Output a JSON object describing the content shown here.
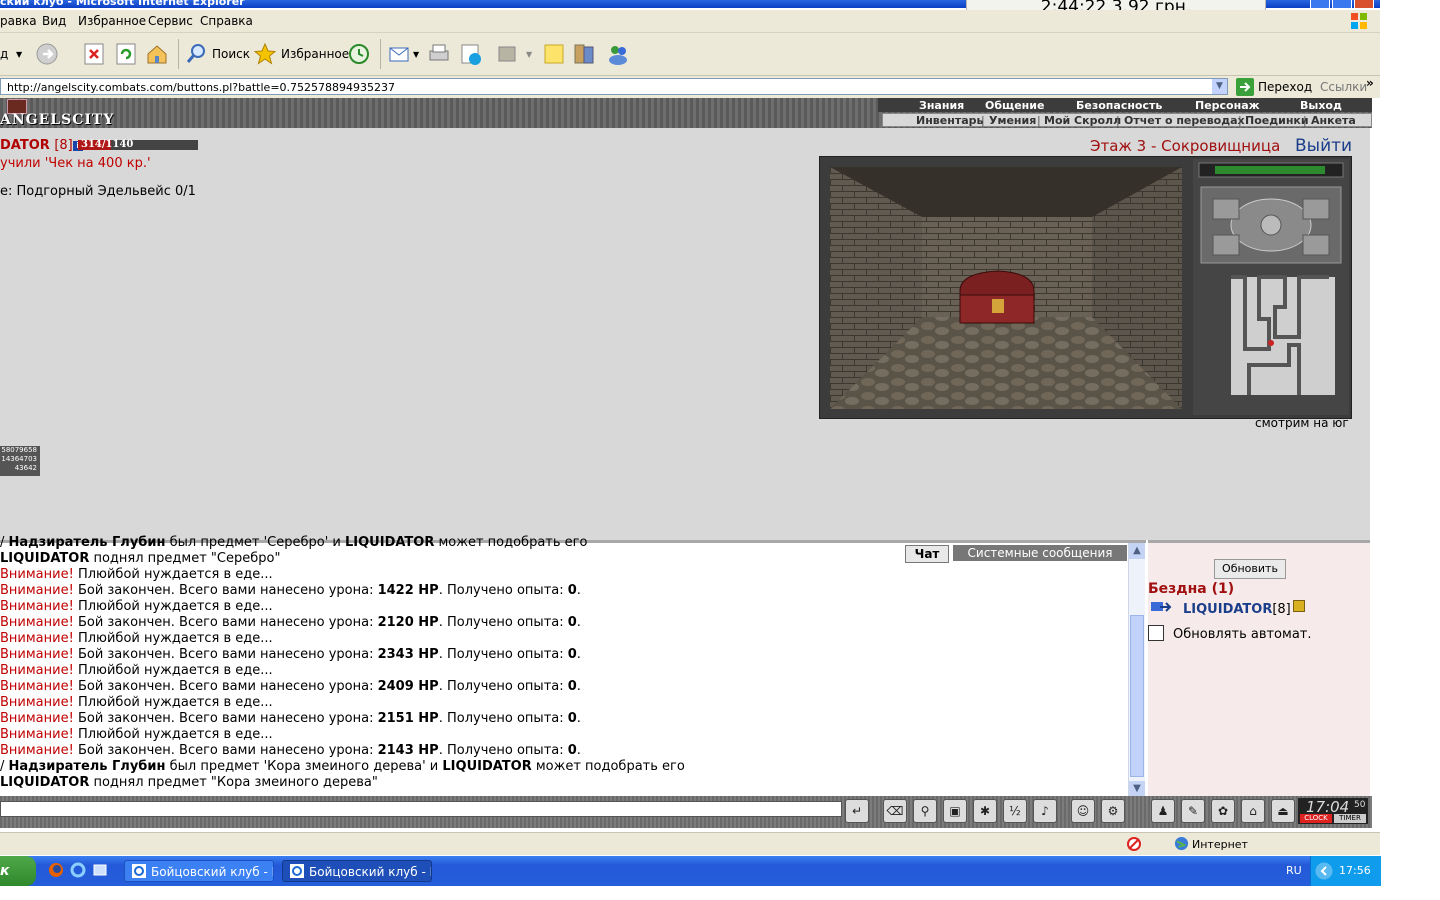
{
  "window": {
    "title": "ский клуб - Microsoft Internet Explorer",
    "clock_popup": "2:44:22  3.92 грн."
  },
  "menu": {
    "items": [
      "равка",
      "Вид",
      "Избранное",
      "Сервис",
      "Справка"
    ]
  },
  "toolbar": {
    "back_label": "д",
    "search_label": "Поиск",
    "favorites_label": "Избранное"
  },
  "address": {
    "url": "http://angelscity.combats.com/buttons.pl?battle=0.752578894935237",
    "go_label": "Переход",
    "links_label": "Ссылки"
  },
  "game": {
    "logo": "ANGELSCITY",
    "nav_top": [
      "Знания",
      "Общение",
      "Безопасность",
      "Персонаж",
      "Выход"
    ],
    "nav_bottom": [
      "Инвентарь",
      "Умения",
      "Мой Скролл",
      "Отчет о переводах",
      "Поединки",
      "Анкета"
    ],
    "player": {
      "name": "DATOR",
      "level": "[8]",
      "hp_text": "314/1140",
      "hp_current": 314,
      "hp_max": 1140
    },
    "receipt_message": "учили 'Чек на 400 кр.'",
    "quest_text": "е: Подгорный Эдельвейс 0/1",
    "coords_lines": [
      "58079658",
      "14364703",
      "43642"
    ],
    "floor_title": "Этаж 3 - Сокровищница",
    "exit_label": "Выйти",
    "facing": "смотрим на юг"
  },
  "chat": {
    "tabs": [
      "Чат",
      "Системные сообщения"
    ],
    "lines": [
      {
        "prefix": "/ ",
        "bold": "Надзиратель Глубин",
        "text": " был предмет 'Серебро' и ",
        "bold2": "LIQUIDATOR",
        "text2": " может подобрать его"
      },
      {
        "prefix": "",
        "bold": "LIQUIDATOR",
        "text": " поднял предмет \"Серебро\"",
        "bold2": "",
        "text2": ""
      },
      {
        "warn": "Внимание!",
        "text": " Плюйбой нуждается в еде..."
      },
      {
        "warn": "Внимание!",
        "text": " Бой закончен. Всего вами нанесено урона: ",
        "dmg": "1422 HP",
        "text2": ". Получено опыта: ",
        "exp": "0",
        "end": "."
      },
      {
        "warn": "Внимание!",
        "text": " Плюйбой нуждается в еде..."
      },
      {
        "warn": "Внимание!",
        "text": " Бой закончен. Всего вами нанесено урона: ",
        "dmg": "2120 HP",
        "text2": ". Получено опыта: ",
        "exp": "0",
        "end": "."
      },
      {
        "warn": "Внимание!",
        "text": " Плюйбой нуждается в еде..."
      },
      {
        "warn": "Внимание!",
        "text": " Бой закончен. Всего вами нанесено урона: ",
        "dmg": "2343 HP",
        "text2": ". Получено опыта: ",
        "exp": "0",
        "end": "."
      },
      {
        "warn": "Внимание!",
        "text": " Плюйбой нуждается в еде..."
      },
      {
        "warn": "Внимание!",
        "text": " Бой закончен. Всего вами нанесено урона: ",
        "dmg": "2409 HP",
        "text2": ". Получено опыта: ",
        "exp": "0",
        "end": "."
      },
      {
        "warn": "Внимание!",
        "text": " Плюйбой нуждается в еде..."
      },
      {
        "warn": "Внимание!",
        "text": " Бой закончен. Всего вами нанесено урона: ",
        "dmg": "2151 HP",
        "text2": ". Получено опыта: ",
        "exp": "0",
        "end": "."
      },
      {
        "warn": "Внимание!",
        "text": " Плюйбой нуждается в еде..."
      },
      {
        "warn": "Внимание!",
        "text": " Бой закончен. Всего вами нанесено урона: ",
        "dmg": "2143 HP",
        "text2": ". Получено опыта: ",
        "exp": "0",
        "end": "."
      },
      {
        "prefix": "/ ",
        "bold": "Надзиратель Глубин",
        "text": " был предмет 'Кора змеиного дерева' и ",
        "bold2": "LIQUIDATOR",
        "text2": " может подобрать его"
      },
      {
        "prefix": "",
        "bold": "LIQUIDATOR",
        "text": " поднял предмет \"Кора змеиного дерева\"",
        "bold2": "",
        "text2": ""
      }
    ]
  },
  "online": {
    "refresh_label": "Обновить",
    "room": "Бездна (1)",
    "user_name": "LIQUIDATOR",
    "user_level": "[8]",
    "auto_label": "Обновлять автомат."
  },
  "game_clock": {
    "time": "17:04",
    "seconds": "50",
    "left_label": "CLOCK",
    "right_label": "TIMER"
  },
  "status": {
    "zone": "Интернет"
  },
  "taskbar": {
    "start_label": "к",
    "tasks": [
      "Бойцовский клуб - M...",
      "Бойцовский клуб - M..."
    ],
    "lang": "RU",
    "time": "17:56"
  },
  "colors": {
    "accent_red": "#c00000",
    "link_blue": "#1a3e8a",
    "xp_blue": "#245edb"
  }
}
